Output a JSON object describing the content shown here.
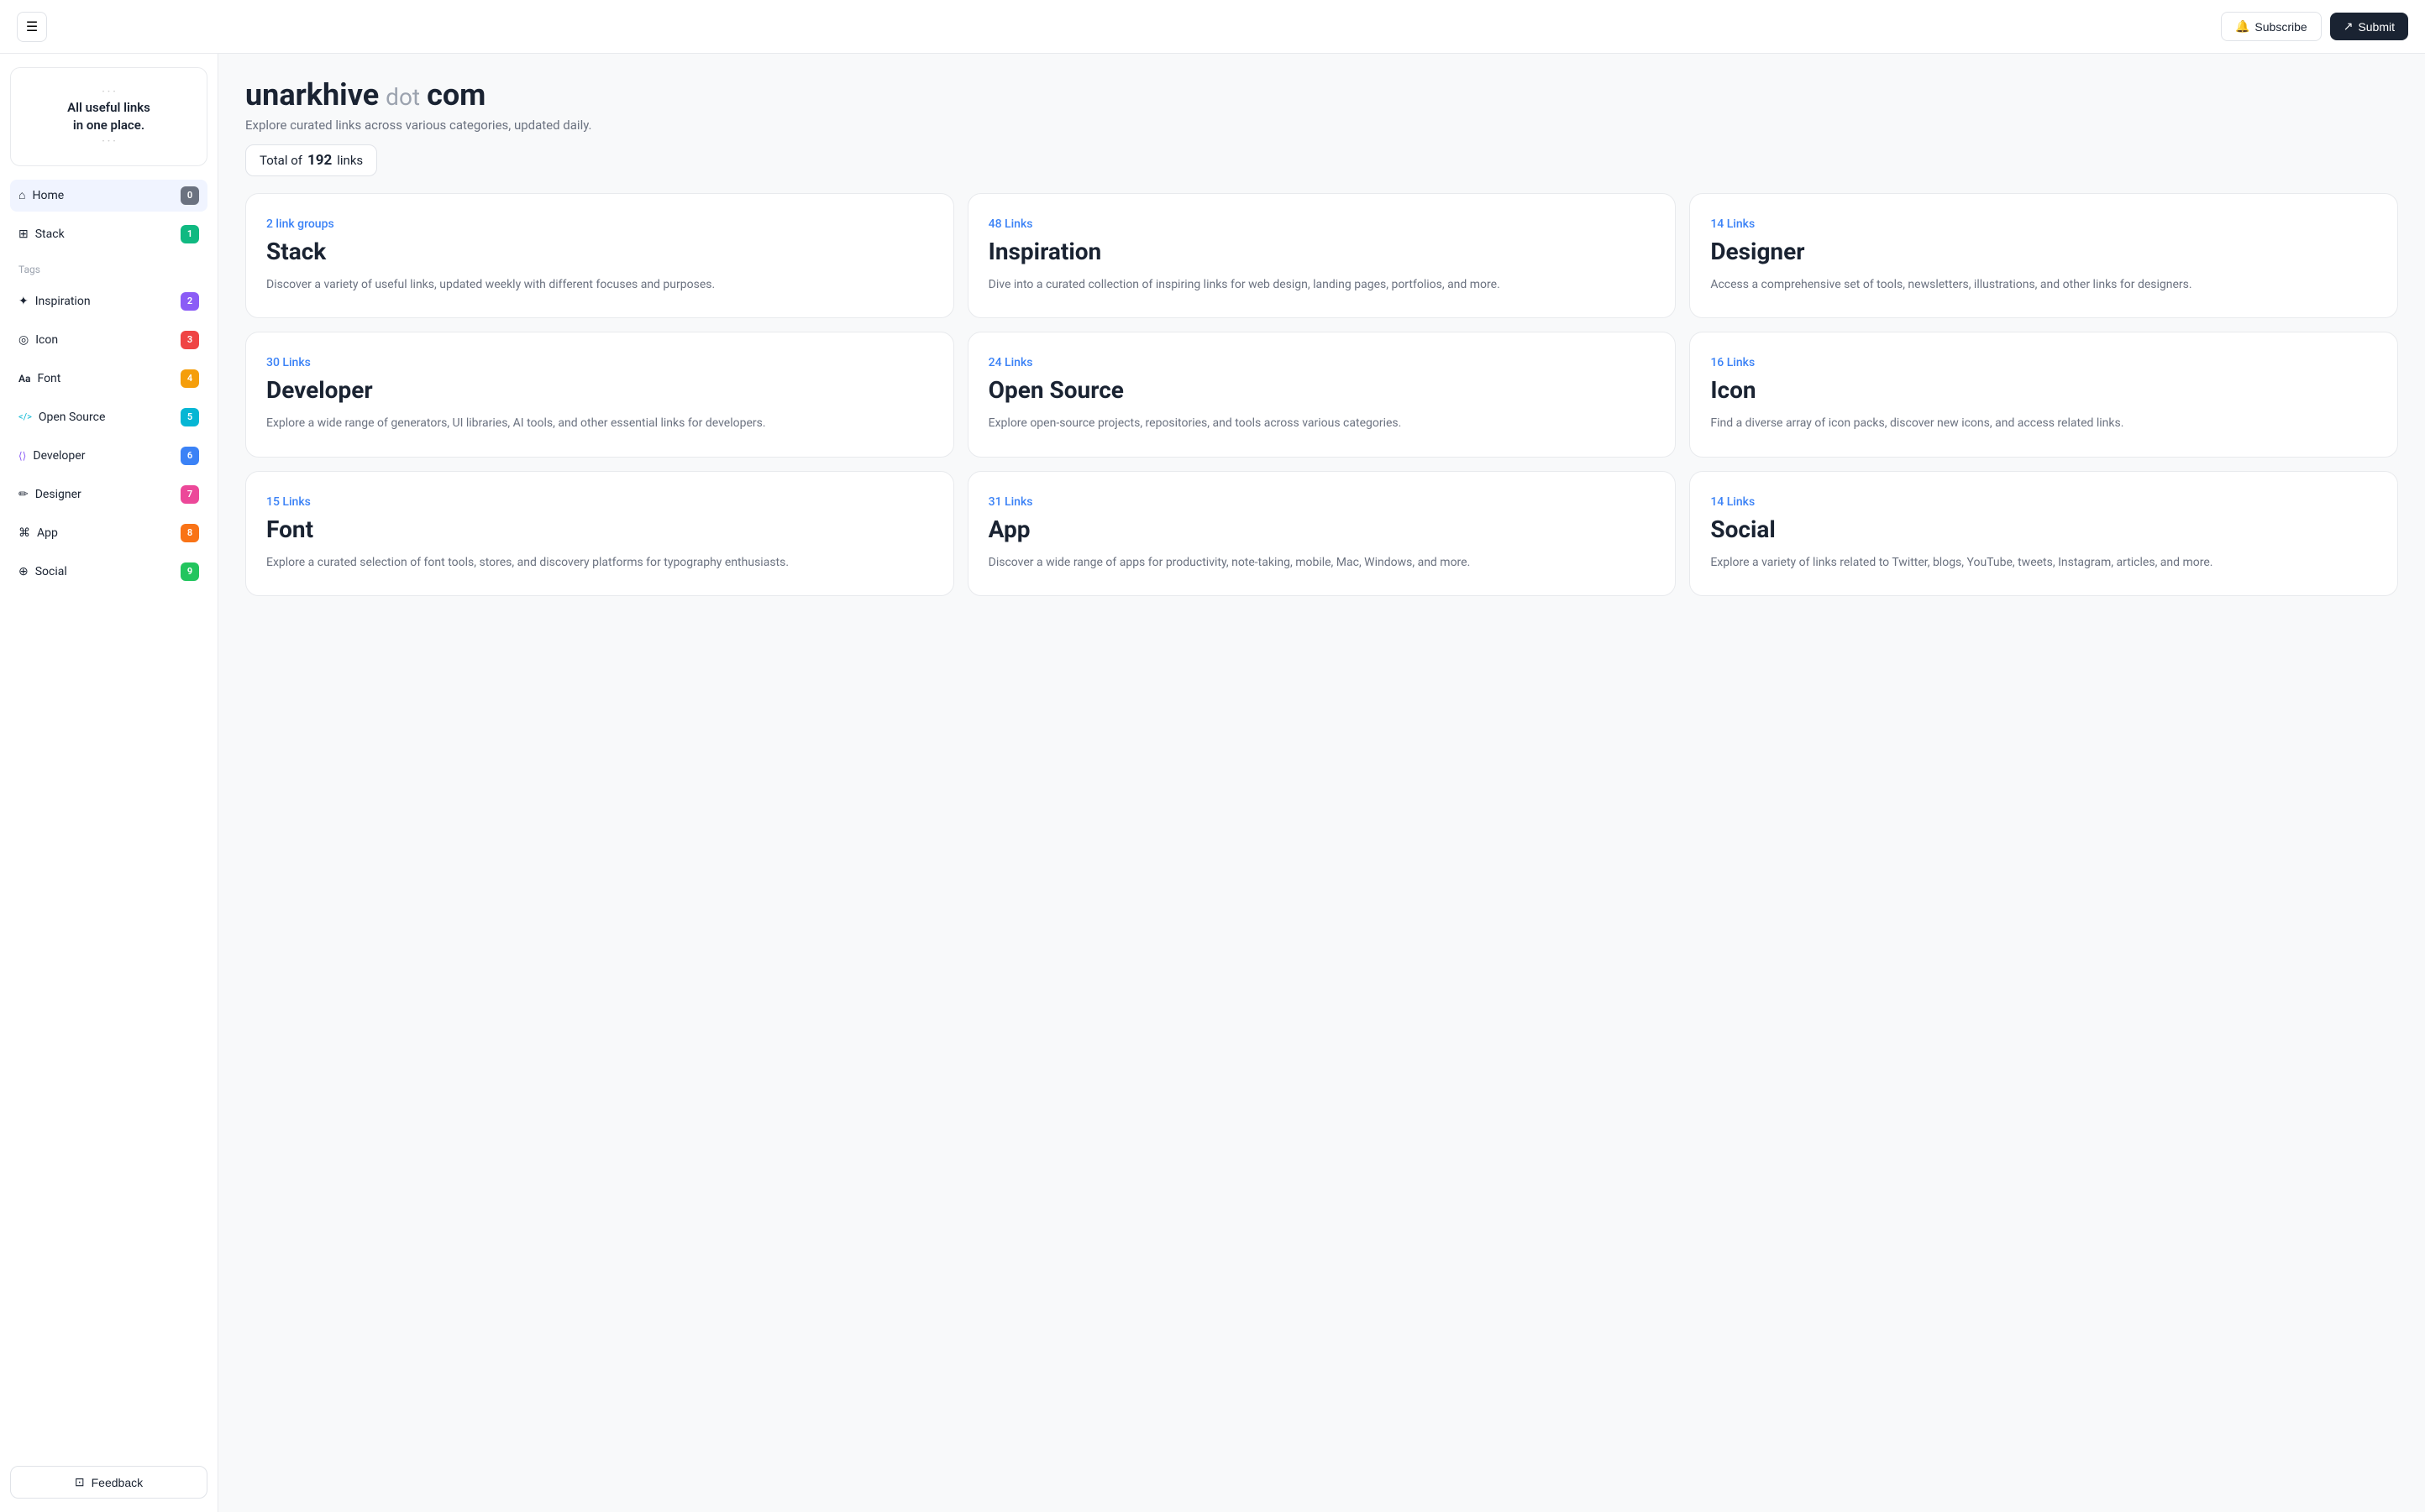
{
  "topnav": {
    "subscribe_label": "Subscribe",
    "submit_label": "Submit"
  },
  "sidebar": {
    "logo_text": "All useful links\nin one place.",
    "nav_items": [
      {
        "id": "home",
        "label": "Home",
        "icon": "home",
        "badge": "0",
        "badge_class": "badge-0",
        "active": true
      },
      {
        "id": "stack",
        "label": "Stack",
        "icon": "stack",
        "badge": "1",
        "badge_class": "badge-1",
        "active": false
      }
    ],
    "tags_label": "Tags",
    "tag_items": [
      {
        "id": "inspiration",
        "label": "Inspiration",
        "icon": "inspiration",
        "badge": "2",
        "badge_class": "badge-2"
      },
      {
        "id": "icon",
        "label": "Icon",
        "icon": "icon",
        "badge": "3",
        "badge_class": "badge-3"
      },
      {
        "id": "font",
        "label": "Font",
        "icon": "font",
        "badge": "4",
        "badge_class": "badge-4"
      },
      {
        "id": "opensource",
        "label": "Open Source",
        "icon": "opensource",
        "badge": "5",
        "badge_class": "badge-5"
      },
      {
        "id": "developer",
        "label": "Developer",
        "icon": "developer",
        "badge": "6",
        "badge_class": "badge-6"
      },
      {
        "id": "designer",
        "label": "Designer",
        "icon": "designer",
        "badge": "7",
        "badge_class": "badge-7"
      },
      {
        "id": "app",
        "label": "App",
        "icon": "app",
        "badge": "8",
        "badge_class": "badge-8"
      },
      {
        "id": "social",
        "label": "Social",
        "icon": "social",
        "badge": "9",
        "badge_class": "badge-9"
      }
    ],
    "feedback_label": "Feedback"
  },
  "main": {
    "title_part1": "unarkhive",
    "title_dot": "dot",
    "title_part2": "com",
    "subtitle": "Explore curated links across various categories, updated daily.",
    "total_prefix": "Total of",
    "total_count": "192",
    "total_suffix": "links",
    "cards": [
      {
        "links_label": "2 link groups",
        "title": "Stack",
        "desc": "Discover a variety of useful links, updated weekly with different focuses and purposes."
      },
      {
        "links_label": "48 Links",
        "title": "Inspiration",
        "desc": "Dive into a curated collection of inspiring links for web design, landing pages, portfolios, and more."
      },
      {
        "links_label": "14 Links",
        "title": "Designer",
        "desc": "Access a comprehensive set of tools, newsletters, illustrations, and other links for designers."
      },
      {
        "links_label": "30 Links",
        "title": "Developer",
        "desc": "Explore a wide range of generators, UI libraries, AI tools, and other essential links for developers."
      },
      {
        "links_label": "24 Links",
        "title": "Open Source",
        "desc": "Explore open-source projects, repositories, and tools across various categories."
      },
      {
        "links_label": "16 Links",
        "title": "Icon",
        "desc": "Find a diverse array of icon packs, discover new icons, and access related links."
      },
      {
        "links_label": "15 Links",
        "title": "Font",
        "desc": "Explore a curated selection of font tools, stores, and discovery platforms for typography enthusiasts."
      },
      {
        "links_label": "31 Links",
        "title": "App",
        "desc": "Discover a wide range of apps for productivity, note-taking, mobile, Mac, Windows, and more."
      },
      {
        "links_label": "14 Links",
        "title": "Social",
        "desc": "Explore a variety of links related to Twitter, blogs, YouTube, tweets, Instagram, articles, and more."
      }
    ]
  }
}
